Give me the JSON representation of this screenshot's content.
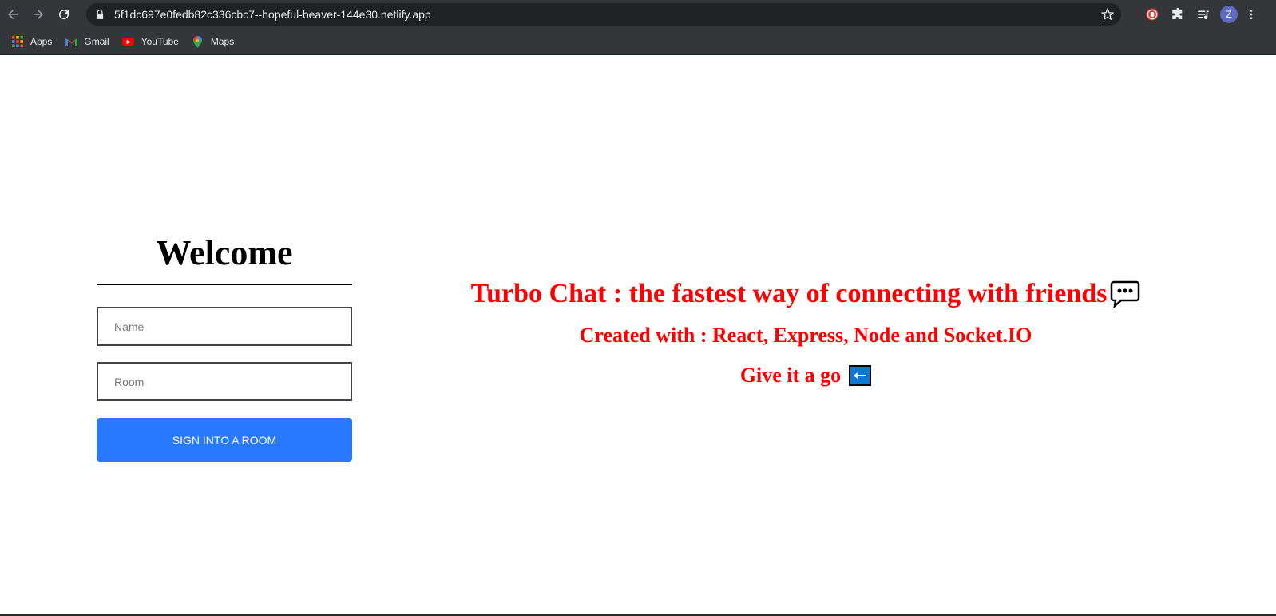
{
  "browser": {
    "url": "5f1dc697e0fedb82c336cbc7--hopeful-beaver-144e30.netlify.app",
    "profile_initial": "Z",
    "bookmarks": [
      {
        "label": "Apps",
        "icon": "apps-grid-icon"
      },
      {
        "label": "Gmail",
        "icon": "gmail-icon"
      },
      {
        "label": "YouTube",
        "icon": "youtube-icon"
      },
      {
        "label": "Maps",
        "icon": "maps-icon"
      }
    ]
  },
  "join": {
    "heading": "Welcome",
    "name_placeholder": "Name",
    "room_placeholder": "Room",
    "button_label": "Sign Into a Room"
  },
  "info": {
    "headline": "Turbo Chat : the fastest way of connecting with friends",
    "tech": "Created with : React, Express, Node and Socket.IO",
    "cta": "Give it a go"
  },
  "colors": {
    "accent_button": "#2979ff",
    "info_text": "#ff0000",
    "chrome_bg": "#35363a"
  }
}
